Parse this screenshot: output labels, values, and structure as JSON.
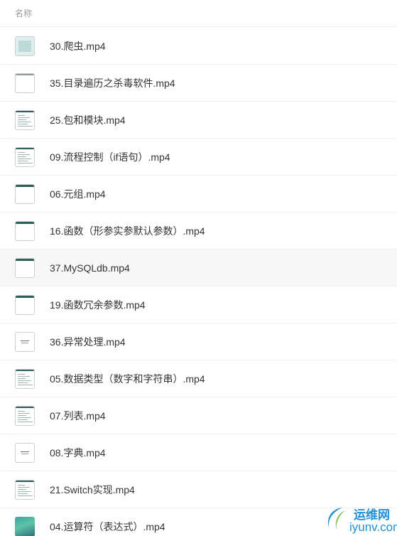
{
  "header": {
    "column_label": "名称"
  },
  "files": [
    {
      "name": "30.爬虫.mp4",
      "thumb": "table"
    },
    {
      "name": "35.目录遍历之杀毒软件.mp4",
      "thumb": "blank"
    },
    {
      "name": "25.包和模块.mp4",
      "thumb": "text"
    },
    {
      "name": "09.流程控制（if语句）.mp4",
      "thumb": "text"
    },
    {
      "name": "06.元组.mp4",
      "thumb": "bar"
    },
    {
      "name": "16.函数（形参实参默认参数）.mp4",
      "thumb": "bar"
    },
    {
      "name": "37.MySQLdb.mp4",
      "thumb": "bar"
    },
    {
      "name": "19.函数冗余参数.mp4",
      "thumb": "bar"
    },
    {
      "name": "36.异常处理.mp4",
      "thumb": "center"
    },
    {
      "name": "05.数据类型（数字和字符串）.mp4",
      "thumb": "text"
    },
    {
      "name": "07.列表.mp4",
      "thumb": "text"
    },
    {
      "name": "08.字典.mp4",
      "thumb": "center"
    },
    {
      "name": "21.Switch实现.mp4",
      "thumb": "text"
    },
    {
      "name": "04.运算符（表达式）.mp4",
      "thumb": "color"
    }
  ],
  "watermark": {
    "cn": "运维网",
    "en": "iyunv.com"
  },
  "colors": {
    "text": "#333333",
    "header_text": "#9a9a9a",
    "accent": "#1f8fd6"
  }
}
